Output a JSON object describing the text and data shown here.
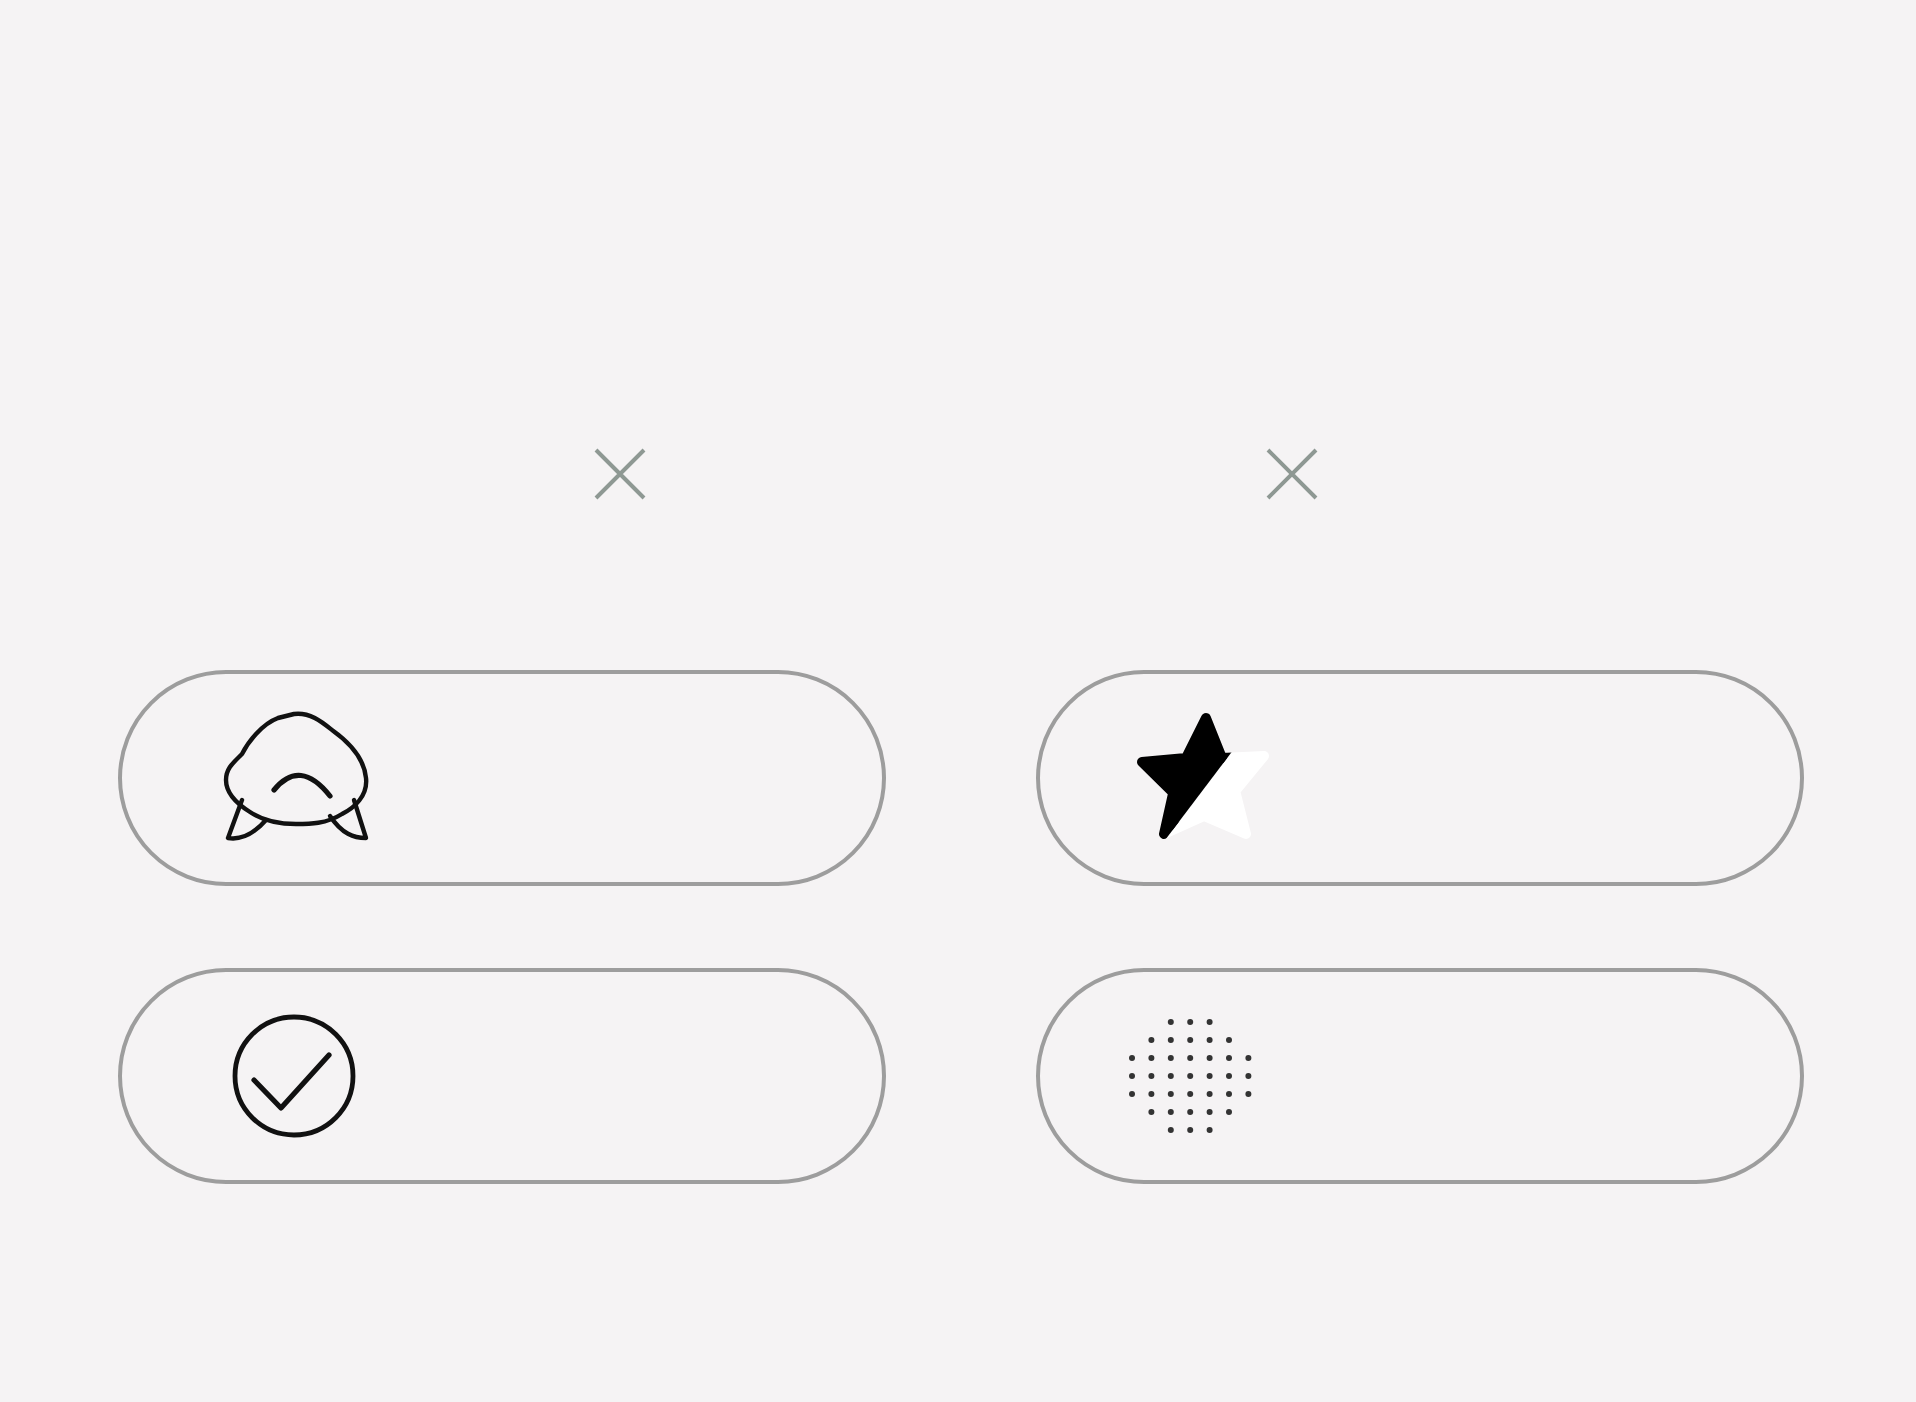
{
  "close_buttons": [
    {
      "kind": "cross"
    },
    {
      "kind": "cross"
    }
  ],
  "options": [
    {
      "kind": "blob"
    },
    {
      "kind": "star"
    },
    {
      "kind": "check"
    },
    {
      "kind": "dots"
    }
  ]
}
